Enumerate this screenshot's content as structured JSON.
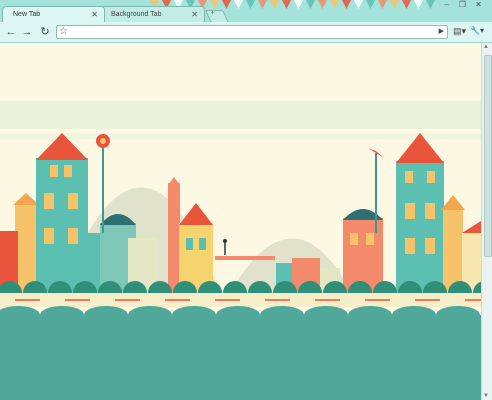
{
  "tabs": [
    {
      "label": "New Tab",
      "active": true
    },
    {
      "label": "Background Tab",
      "active": false
    }
  ],
  "window_controls": {
    "minimize": "‒",
    "maximize": "❐",
    "close": "✕"
  },
  "toolbar": {
    "back": "←",
    "forward": "→",
    "reload": "↻",
    "star": "☆",
    "go": "▶",
    "page_menu": "▤▾",
    "wrench_menu": "🔧▾"
  },
  "omnibox": {
    "value": "",
    "placeholder": ""
  },
  "colors": {
    "frame": "#a3e3db",
    "toolbar": "#dcf7f3",
    "page_bg": "#fdf8e4",
    "sea": "#4fa89a",
    "roof_red": "#e8553a"
  }
}
